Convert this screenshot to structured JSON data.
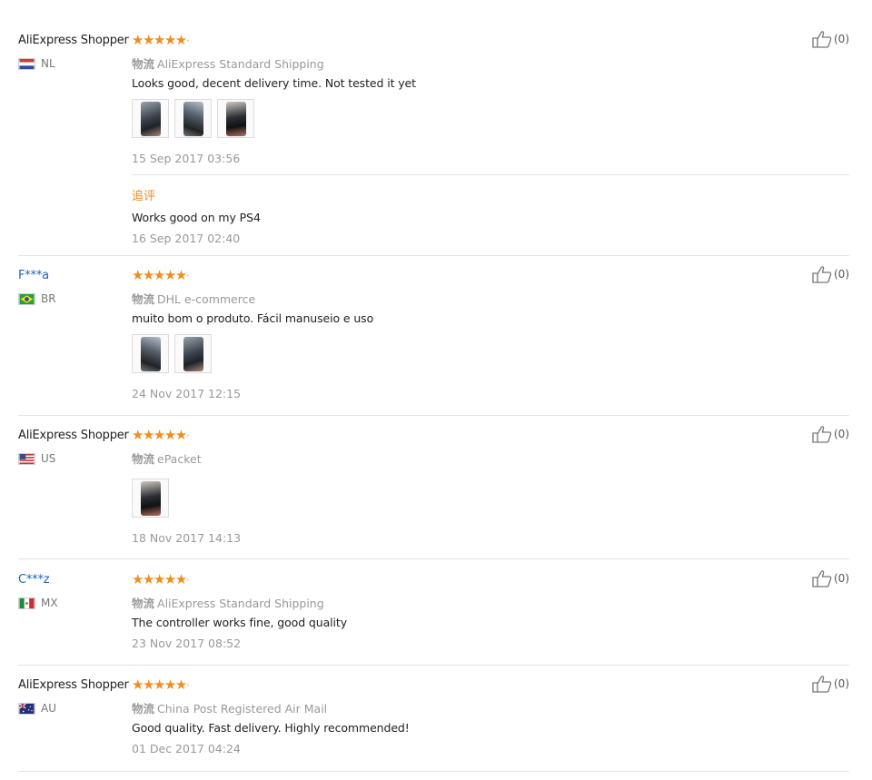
{
  "reviews": [
    {
      "user": "AliExpress Shopper",
      "country": "NL",
      "stars": "★★★★★",
      "shipping_label": "物流",
      "shipping": "AliExpress Standard Shipping",
      "text": "Looks good, decent delivery time. Not tested it yet",
      "photos": 3,
      "date": "15 Sep 2017 03:56",
      "followup_label": "追评",
      "followup_text": "Works good on my PS4",
      "followup_date": "16 Sep 2017 02:40",
      "likes": "(0)"
    },
    {
      "user": "F***a",
      "country": "BR",
      "stars": "★★★★★",
      "shipping_label": "物流",
      "shipping": "DHL e-commerce",
      "text": "muito bom o produto. Fácil manuseio e uso",
      "photos": 2,
      "date": "24 Nov 2017 12:15",
      "likes": "(0)"
    },
    {
      "user": "AliExpress Shopper",
      "country": "US",
      "stars": "★★★★★",
      "shipping_label": "物流",
      "shipping": "ePacket",
      "photos": 1,
      "date": "18 Nov 2017 14:13",
      "likes": "(0)"
    },
    {
      "user": "C***z",
      "country": "MX",
      "stars": "★★★★★",
      "shipping_label": "物流",
      "shipping": "AliExpress Standard Shipping",
      "text": "The controller works fine, good quality",
      "photos": 0,
      "date": "23 Nov 2017 08:52",
      "likes": "(0)"
    },
    {
      "user": "AliExpress Shopper",
      "country": "AU",
      "stars": "★★★★★",
      "shipping_label": "物流",
      "shipping": "China Post Registered Air Mail",
      "text": "Good quality. Fast delivery. Highly recommended!",
      "photos": 0,
      "date": "01 Dec 2017 04:24",
      "likes": "(0)"
    }
  ],
  "colors": {
    "star": "#f28c1c",
    "followup": "#f08a1c",
    "masked_user": "#1a64b8",
    "meta": "#999999"
  },
  "icons": {
    "rating": "star-icon",
    "like": "thumbs-up-icon",
    "flag": "country-flag-icon",
    "photo": "review-photo"
  }
}
